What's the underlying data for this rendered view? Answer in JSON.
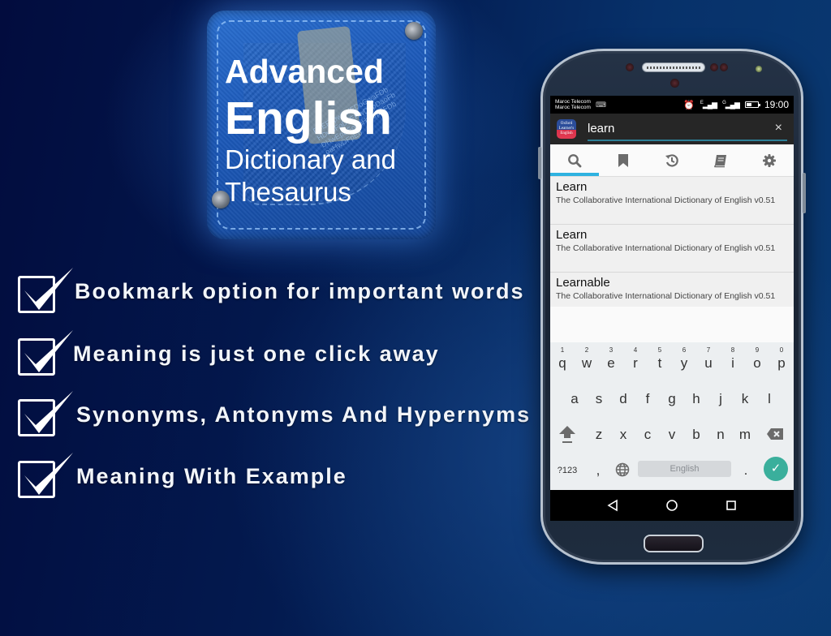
{
  "app_icon": {
    "title_line1": "Advanced",
    "title_line2": "English",
    "title_line3": "Dictionary and",
    "title_line4": "Thesaurus",
    "decoration_letters": "DoEFbpwDHFDoGwaFDbHDwpFoDbEHwDFpDaoFbDHwEpDFoabHwDpEFDboaHwDFpEo"
  },
  "features": [
    {
      "label": "Bookmark option for important words",
      "icon": "checkbox-checked-icon"
    },
    {
      "label": "Meaning is just one click away",
      "icon": "checkbox-checked-icon"
    },
    {
      "label": "Synonyms, Antonyms And Hypernyms",
      "icon": "checkbox-checked-icon"
    },
    {
      "label": "Meaning With Example",
      "icon": "checkbox-checked-icon"
    }
  ],
  "phone": {
    "statusbar": {
      "carrier1": "Maroc Telecom",
      "carrier2": "Maroc Telecom",
      "time": "19:00",
      "signal1_label": "E",
      "signal2_label": "G",
      "icons": [
        "keyboard-icon",
        "alarm-icon",
        "signal-icon",
        "signal-icon",
        "battery-icon"
      ]
    },
    "toolbar": {
      "logo_text": "Oxford Learner's English",
      "search_value": "learn",
      "clear_label": "×"
    },
    "tabs": [
      {
        "name": "search",
        "icon": "search-icon",
        "active": true
      },
      {
        "name": "bookmarks",
        "icon": "bookmark-icon",
        "active": false
      },
      {
        "name": "history",
        "icon": "history-icon",
        "active": false
      },
      {
        "name": "dictionaries",
        "icon": "book-icon",
        "active": false
      },
      {
        "name": "settings",
        "icon": "gear-icon",
        "active": false
      }
    ],
    "results": [
      {
        "word": "Learn",
        "source": "The Collaborative International Dictionary of English v0.51"
      },
      {
        "word": "Learn",
        "source": "The Collaborative International Dictionary of English v0.51"
      },
      {
        "word": "Learnable",
        "source": "The Collaborative International Dictionary of English v0.51"
      }
    ],
    "keyboard": {
      "row1": [
        "q",
        "w",
        "e",
        "r",
        "t",
        "y",
        "u",
        "i",
        "o",
        "p"
      ],
      "row1_hints": [
        "1",
        "2",
        "3",
        "4",
        "5",
        "6",
        "7",
        "8",
        "9",
        "0"
      ],
      "row2": [
        "a",
        "s",
        "d",
        "f",
        "g",
        "h",
        "j",
        "k",
        "l"
      ],
      "row3": [
        "z",
        "x",
        "c",
        "v",
        "b",
        "n",
        "m"
      ],
      "symbols_label": "?123",
      "comma": ",",
      "space_label": "English",
      "period": ".",
      "enter_label": "✓"
    },
    "colors": {
      "accent": "#2eb2e0",
      "search_underline": "#2c7f96",
      "enter_key": "#3aaf9c"
    }
  }
}
